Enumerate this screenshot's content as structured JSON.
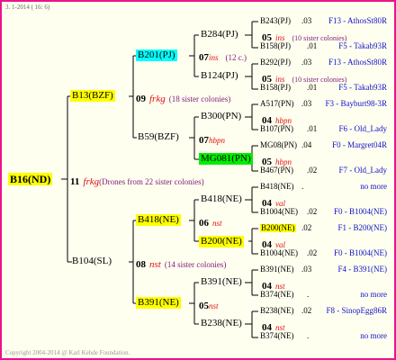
{
  "header": {
    "date": "3.  1-2014 ( 16:  6)"
  },
  "colors": {
    "frame": "#e8148c",
    "highlight_yellow": "#ffff00",
    "highlight_cyan": "#00ffff",
    "highlight_green": "#00ee00",
    "drone_note": "#80207a",
    "mark": "#e01010",
    "link": "#1010c8"
  },
  "root": {
    "label": "B16(ND)"
  },
  "gen1": {
    "num": "11",
    "mark": "frkg",
    "note": "(Drones from 22 sister colonies)"
  },
  "q_b13": {
    "label": "B13(BZF)",
    "num": "09",
    "mark": "frkg",
    "note": "(18 sister colonies)"
  },
  "q_b104": {
    "label": "B104(SL)",
    "num": "08",
    "mark": "nst",
    "note": "(14 sister colonies)"
  },
  "q_b201": {
    "label": "B201(PJ)",
    "num": "07",
    "mark": "ins",
    "note": "(12 c.)"
  },
  "q_b59": {
    "label": "B59(BZF)",
    "num": "07",
    "mark": "hbpn"
  },
  "q_b418a": {
    "label": "B418(NE)",
    "num": "06",
    "mark": "nst"
  },
  "q_b391a": {
    "label": "B391(NE)",
    "num": "05",
    "mark": "nst"
  },
  "g4": {
    "b284": {
      "label": "B284(PJ)"
    },
    "b124": {
      "label": "B124(PJ)"
    },
    "b300": {
      "label": "B300(PN)"
    },
    "mg081": {
      "label": "MG081(PN)"
    },
    "b418b": {
      "label": "B418(NE)"
    },
    "b200": {
      "label": "B200(NE)"
    },
    "b391b": {
      "label": "B391(NE)"
    },
    "b238": {
      "label": "B238(NE)"
    }
  },
  "leaves": [
    {
      "a": "B243(PJ)",
      "av": ".03",
      "al": "F13 - AthosSt80R",
      "num": "05",
      "mark": "ins",
      "note": "(10 sister colonies)",
      "b": "B158(PJ)",
      "bv": ".01",
      "bl": "F5 - Takab93R"
    },
    {
      "a": "B292(PJ)",
      "av": ".03",
      "al": "F13 - AthosSt80R",
      "num": "05",
      "mark": "ins",
      "note": "(10 sister colonies)",
      "b": "B158(PJ)",
      "bv": ".01",
      "bl": "F5 - Takab93R"
    },
    {
      "a": "A517(PN)",
      "av": ".03",
      "al": "F3 - Bayburt98-3R",
      "num": "04",
      "mark": "hbpn",
      "note": "",
      "b": "B107(PN)",
      "bv": ".01",
      "bl": "F6 - Old_Lady"
    },
    {
      "a": "MG08(PN)",
      "av": ".04",
      "al": "F0 - Margret04R",
      "num": "05",
      "mark": "hbpn",
      "note": "",
      "b": "B467(PN)",
      "bv": ".02",
      "bl": "F7 - Old_Lady"
    },
    {
      "a": "B418(NE)",
      "av": ".",
      "al": "no more",
      "num": "04",
      "mark": "val",
      "note": "",
      "b": "B1004(NE)",
      "bv": ".02",
      "bl": "F0 - B1004(NE)"
    },
    {
      "a": "B200(NE)",
      "av": ".02",
      "al": "F1 - B200(NE)",
      "num": "04",
      "mark": "val",
      "note": "",
      "b": "B1004(NE)",
      "bv": ".02",
      "bl": "F0 - B1004(NE)"
    },
    {
      "a": "B391(NE)",
      "av": ".03",
      "al": "F4 - B391(NE)",
      "num": "04",
      "mark": "nst",
      "note": "",
      "b": "B374(NE)",
      "bv": ".",
      "bl": "no more"
    },
    {
      "a": "B238(NE)",
      "av": ".02",
      "al": "F8 - SinopEgg86R",
      "num": "04",
      "mark": "nst",
      "note": "",
      "b": "B374(NE)",
      "bv": ".",
      "bl": "no more"
    }
  ],
  "footer": {
    "copyright": "Copyright 2004-2014 @ Karl Kehde Foundation."
  }
}
